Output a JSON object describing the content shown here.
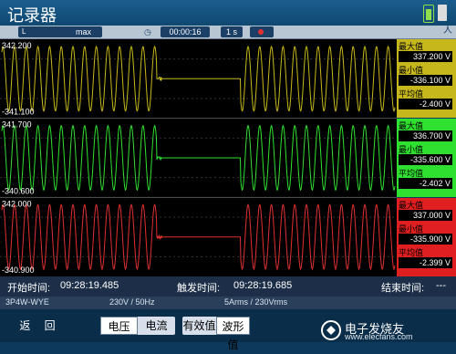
{
  "app": {
    "title": "记录器"
  },
  "toolbar": {
    "mode_prefix": "L",
    "mode": "max",
    "time": "00:00:16",
    "interval": "1 s"
  },
  "channels": [
    {
      "color": "#c6b81c",
      "bg": "#c6b81c",
      "ytop": "342.200",
      "ybottom": "-341.100",
      "max_label": "最大值",
      "max": "337.200 V",
      "min_label": "最小值",
      "min": "-336.100 V",
      "avg_label": "平均值",
      "avg": "-2.400 V"
    },
    {
      "color": "#30e030",
      "bg": "#30e030",
      "ytop": "341.700",
      "ybottom": "-340.600",
      "max_label": "最大值",
      "max": "336.700 V",
      "min_label": "最小值",
      "min": "-335.600 V",
      "avg_label": "平均值",
      "avg": "-2.402 V"
    },
    {
      "color": "#e03030",
      "bg": "#e02020",
      "ytop": "342.000",
      "ybottom": "-340.900",
      "max_label": "最大值",
      "max": "337.000 V",
      "min_label": "最小值",
      "min": "-335.900 V",
      "avg_label": "平均值",
      "avg": "-2.399 V"
    }
  ],
  "trigger": {
    "start_label": "开始时间:",
    "start": "09:28:19.485",
    "trig_label": "触发时间:",
    "trig": "09:28:19.685",
    "end_label": "结束时间:",
    "end": "---"
  },
  "config": {
    "topology": "3P4W-WYE",
    "voltage": "230V / 50Hz",
    "range": "5Arms / 230Vrms"
  },
  "softkeys": {
    "back": "返 回",
    "voltage": "电压",
    "current": "电流",
    "rms": "有效值",
    "waveform": "波形值"
  },
  "logo": {
    "text": "电子发烧友",
    "sub": "www.elecfans.com"
  },
  "icons": {
    "clock": "clock-icon",
    "record": "record-icon",
    "person": "person-icon"
  }
}
